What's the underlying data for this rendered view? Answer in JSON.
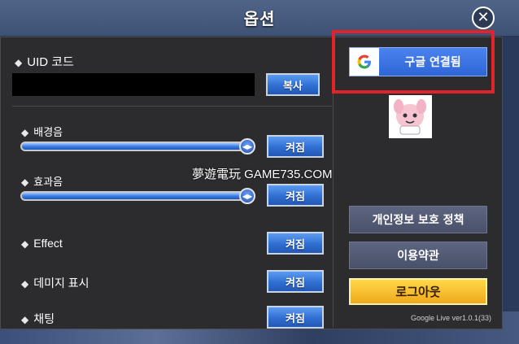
{
  "header": {
    "title": "옵션",
    "close_icon": "close-icon"
  },
  "uid": {
    "label": "UID 코드",
    "copy_label": "복사"
  },
  "sound": {
    "bgm_label": "배경음",
    "bgm_toggle": "켜짐",
    "bgm_level": 1.0,
    "sfx_label": "효과음",
    "sfx_toggle": "켜짐",
    "sfx_level": 1.0
  },
  "effect": {
    "label": "Effect",
    "toggle": "켜짐"
  },
  "damage": {
    "label": "데미지 표시",
    "toggle": "켜짐"
  },
  "chat": {
    "label": "채팅",
    "toggle": "켜짐"
  },
  "account": {
    "google_label": "구글 연결됨",
    "google_icon": "google-g-icon",
    "privacy_label": "개인정보 보호 정책",
    "terms_label": "이용약관",
    "logout_label": "로그아웃",
    "version": "Google Live ver1.0.1(33)"
  },
  "watermark": "夢遊電玩 GAME735.COM",
  "colors": {
    "highlight": "#e0242a",
    "accent": "#2f6fd3",
    "logout": "#f0a81c"
  }
}
